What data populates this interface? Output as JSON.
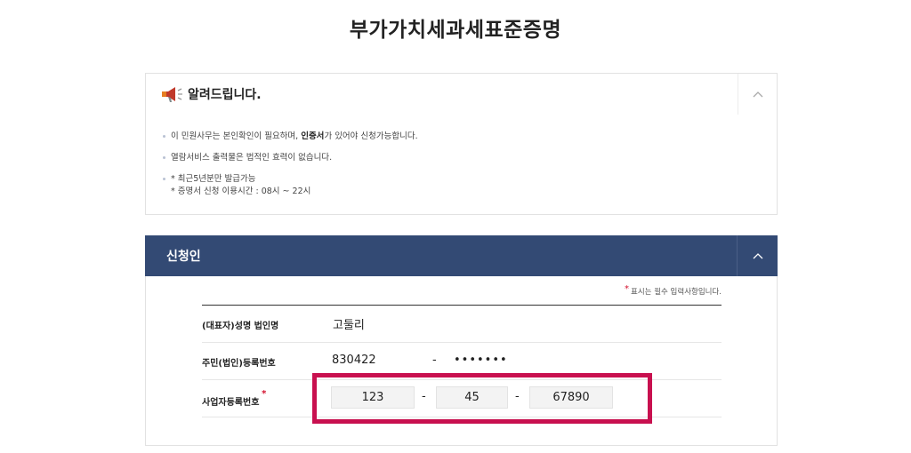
{
  "page": {
    "title": "부가가치세과세표준증명"
  },
  "notice": {
    "title": "알려드립니다.",
    "items": [
      {
        "before": "이 민원사무는 본인확인이 필요하며, ",
        "bold": "인증서",
        "after": "가 있어야 신청가능합니다."
      },
      {
        "text": "열람서비스 출력물은 법적인 효력이 없습니다."
      },
      {
        "line1": "* 최근5년분만 발급가능",
        "line2": "* 증명서 신청 이용시간 : 08시 ~ 22시"
      }
    ],
    "icon": "megaphone-icon",
    "toggle_icon": "chevron-up-icon"
  },
  "applicant": {
    "title": "신청인",
    "toggle_icon": "chevron-up-icon",
    "required_note": "표시는 필수 입력사항입니다.",
    "required_mark": "*",
    "rows": {
      "name": {
        "label": "(대표자)성명 법인명",
        "value": "고둘리"
      },
      "rrn": {
        "label": "주민(법인)등록번호",
        "front": "830422",
        "separator": "-",
        "back": "•••••••"
      },
      "brn": {
        "label": "사업자등록번호",
        "part1": "123",
        "part2": "45",
        "part3": "67890",
        "separator": "-"
      }
    }
  },
  "colors": {
    "header": "#334a74",
    "required": "#d3102d",
    "highlight": "#c8104f"
  }
}
